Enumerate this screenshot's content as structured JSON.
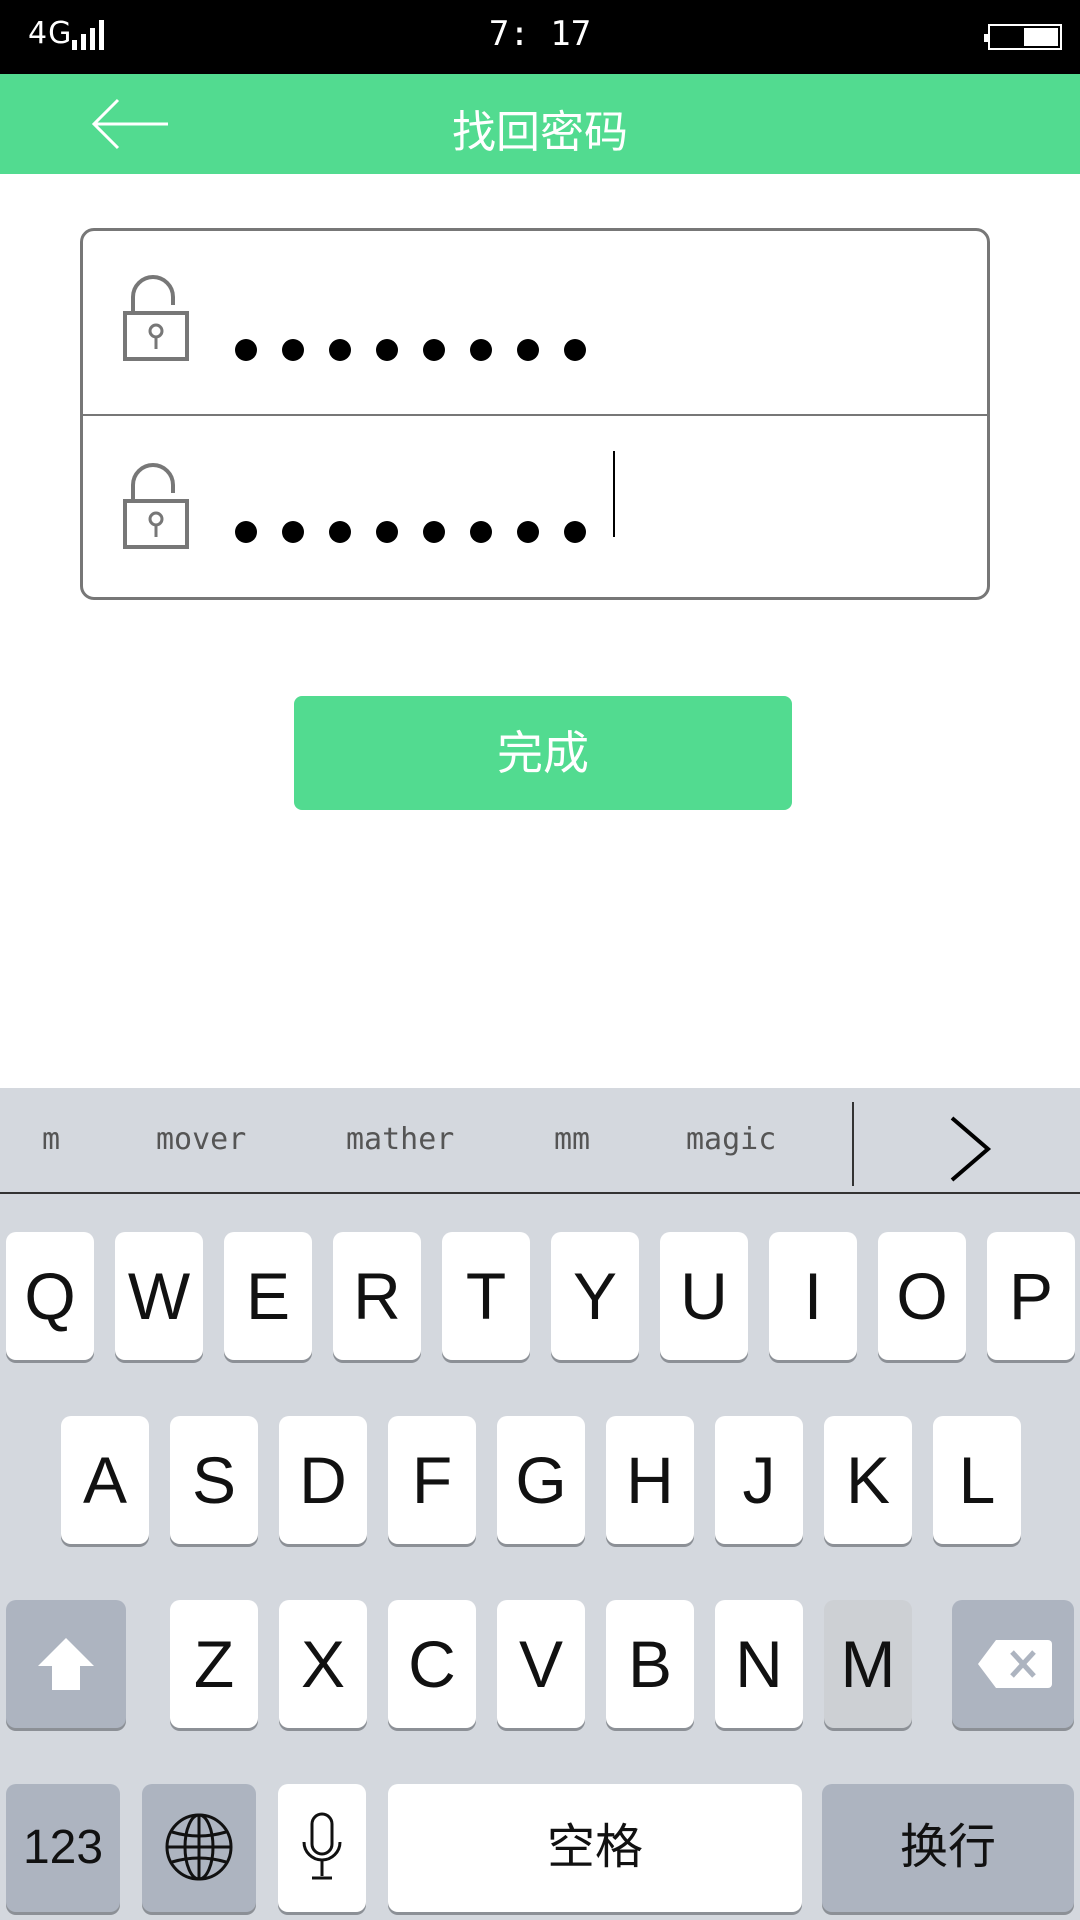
{
  "status_bar": {
    "network": "4G",
    "time": "7: 17"
  },
  "header": {
    "title": "找回密码",
    "back_icon": "arrow-left-icon"
  },
  "form": {
    "password_field": {
      "icon": "unlock-icon",
      "masked_length": 8
    },
    "confirm_field": {
      "icon": "unlock-icon",
      "masked_length": 8
    }
  },
  "done_button": {
    "label": "完成"
  },
  "keyboard": {
    "suggestions": [
      "m",
      "mover",
      "mather",
      "mm",
      "magic"
    ],
    "row1": [
      "Q",
      "W",
      "E",
      "R",
      "T",
      "Y",
      "U",
      "I",
      "O",
      "P"
    ],
    "row2": [
      "A",
      "S",
      "D",
      "F",
      "G",
      "H",
      "J",
      "K",
      "L"
    ],
    "row3": [
      "Z",
      "X",
      "C",
      "V",
      "B",
      "N",
      "M"
    ],
    "numbers_label": "123",
    "space_label": "空格",
    "return_label": "换行",
    "pressed_key": "M"
  },
  "colors": {
    "accent": "#52db90",
    "keyboard_bg": "#d4d8de",
    "function_key": "#adb4c0"
  }
}
